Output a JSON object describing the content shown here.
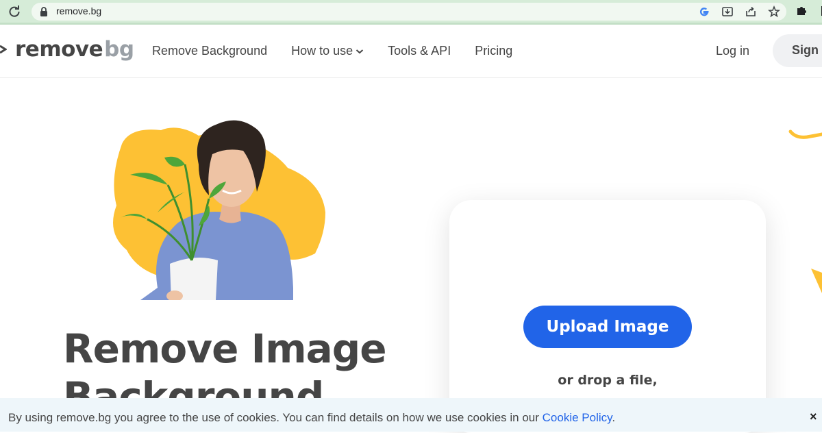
{
  "browser": {
    "url": "remove.bg",
    "icons": [
      "reload-icon",
      "lock-icon",
      "google-icon",
      "install-icon",
      "share-icon",
      "bookmark-star-icon",
      "extensions-puzzle-icon"
    ]
  },
  "header": {
    "logo_part1": "remove",
    "logo_part2": "bg",
    "nav": [
      "Remove Background",
      "How to use",
      "Tools & API",
      "Pricing"
    ],
    "login": "Log in",
    "signup": "Sign up"
  },
  "hero": {
    "headline_line1": "Remove Image",
    "headline_line2": "Background",
    "illustration": "person-holding-plant-image"
  },
  "upload": {
    "button": "Upload Image",
    "drop_text": "or drop a file,"
  },
  "cookie": {
    "text": "By using remove.bg you agree to the use of cookies. You can find details on how we use cookies in our ",
    "link": "Cookie Policy",
    "end": ".",
    "close": "×"
  },
  "colors": {
    "accent_blue": "#2164e8",
    "text_dark": "#454545",
    "yellow": "#fdc134",
    "chrome_green": "#d6ecd8"
  }
}
